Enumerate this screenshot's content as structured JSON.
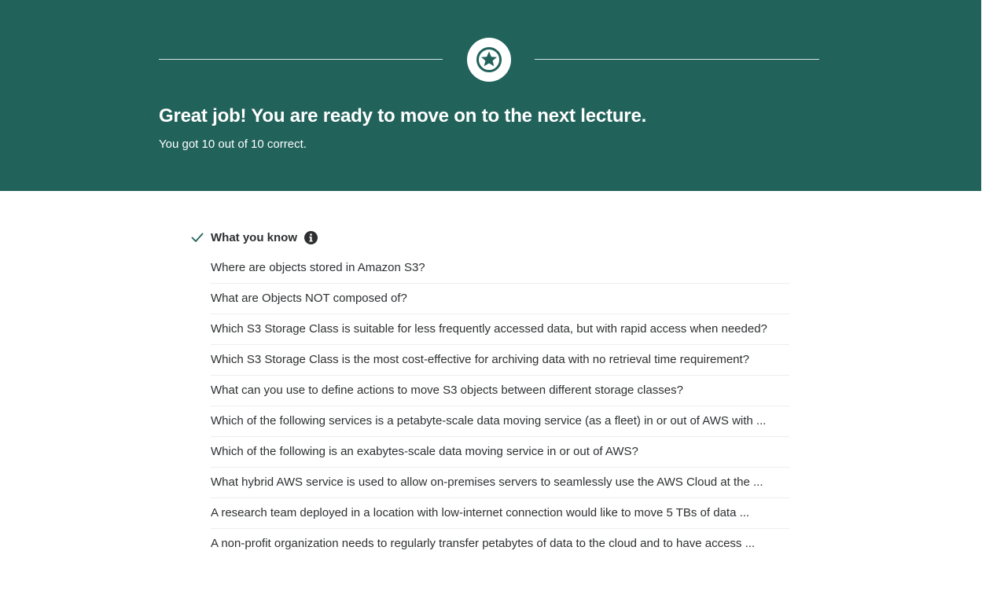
{
  "banner": {
    "headline": "Great job! You are ready to move on to the next lecture.",
    "score_text": "You got 10 out of 10 correct.",
    "color": "#21625a",
    "badge_icon": "star-icon"
  },
  "know_section": {
    "title": "What you know",
    "check_icon": "check-icon",
    "info_icon": "info-icon",
    "accent_color": "#21625a"
  },
  "questions": [
    "Where are objects stored in Amazon S3?",
    "What are Objects NOT composed of?",
    "Which S3 Storage Class is suitable for less frequently accessed data, but with rapid access when needed?",
    "Which S3 Storage Class is the most cost-effective for archiving data with no retrieval time requirement?",
    "What can you use to define actions to move S3 objects between different storage classes?",
    "Which of the following services is a petabyte-scale data moving service (as a fleet) in or out of AWS with ...",
    "Which of the following is an exabytes-scale data moving service in or out of AWS?",
    "What hybrid AWS service is used to allow on-premises servers to seamlessly use the AWS Cloud at the ...",
    "A research team deployed in a location with low-internet connection would like to move 5 TBs of data ...",
    "A non-profit organization needs to regularly transfer petabytes of data to the cloud and to have access ..."
  ]
}
